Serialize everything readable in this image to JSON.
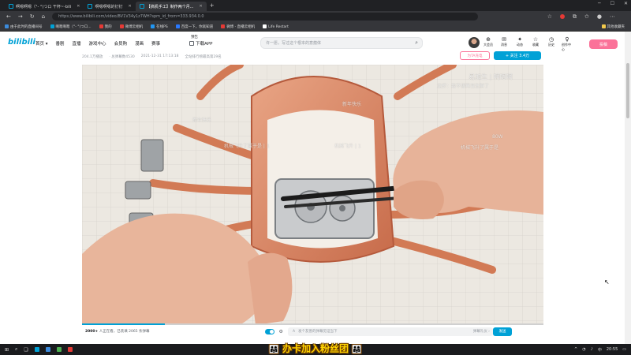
{
  "browser": {
    "tabs": [
      {
        "title": "啊嗯啊嗯（°- °)つロ 干杯~-bili",
        "active": false
      },
      {
        "title": "啊嗯啊嗯的钉钉",
        "active": false
      },
      {
        "title": "【搞机手工】制作两个月...",
        "active": true
      }
    ],
    "url": "https://www.bilibili.com/video/BV1V34y1z7WH?spm_id_from=333.934.0.0",
    "bookmarks": [
      {
        "label": "由于此时的直播间号",
        "color": "#3c8bdc"
      },
      {
        "label": "啊嗯啊嗯（°- °)つロ...",
        "color": "#00a1d6"
      },
      {
        "label": "我的",
        "color": "#e53935"
      },
      {
        "label": "微博云相机",
        "color": "#e53935"
      },
      {
        "label": "在线PS",
        "color": "#2196f3"
      },
      {
        "label": "百度一下，你就知道",
        "color": "#2979ff"
      },
      {
        "label": "微博 - 直播云相机",
        "color": "#e53935"
      },
      {
        "label": "Life Restart",
        "color": "#ffffff"
      }
    ],
    "bookmarks_other": "其他收藏夹"
  },
  "site": {
    "logo": "bilibili",
    "nav": [
      "首页 ▾",
      "番剧",
      "直播",
      "游戏中心",
      "会员购",
      "漫画",
      "赛事"
    ],
    "nav_badge": "预告",
    "download": "下载APP",
    "search_placeholder": "许一愿，写过这个根本的意蕴体",
    "header_items": [
      {
        "icon": "⊕",
        "label": "大会员"
      },
      {
        "icon": "✉",
        "label": "消息"
      },
      {
        "icon": "✦",
        "label": "动态"
      },
      {
        "icon": "☆",
        "label": "收藏"
      },
      {
        "icon": "◷",
        "label": "历史"
      },
      {
        "icon": "♀",
        "label": "创作中心"
      }
    ],
    "upload": "投稿"
  },
  "video": {
    "meta": [
      "204.1万播放",
      "·  总弹幕数4530",
      "2021-12-31 17:13:18",
      "全站排行榜最高第29名"
    ],
    "charge": "为TA充电",
    "follow": "+ 关注 3.4万",
    "danmaku_overlay": [
      "易加生 | 啊嗯啊",
      "新年快乐",
      "新年快乐",
      "机械飞升 | 1",
      "机械飞升了属于是",
      "80W",
      "机械飞升了属于是 | 1",
      "龙虾：我不想再当生鲜了"
    ],
    "progress": 0.18,
    "viewers_count": "2000+",
    "viewers_text": "人正在看，已装填 2065 条弹幕",
    "danmaku_placeholder": "发个友善的弹幕见证当下",
    "danmaku_etiquette": "弹幕礼仪 ›",
    "send": "发送"
  },
  "caption": {
    "text": "办卡加入粉丝团",
    "emoji": "👨‍👩‍👧"
  },
  "taskbar": {
    "time": "20:55",
    "lang": "中"
  }
}
